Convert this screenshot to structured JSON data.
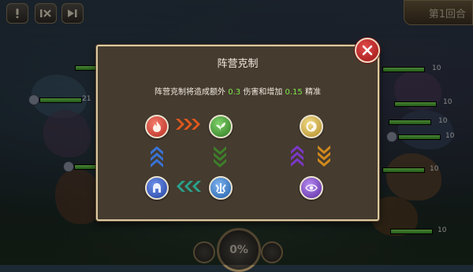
{
  "hud": {
    "round_label": "第1回合",
    "energy_label": "0%"
  },
  "units": {
    "left_levels": [
      "21"
    ],
    "right_levels": [
      "10",
      "10",
      "10",
      "10",
      "10",
      "10"
    ]
  },
  "dialog": {
    "title": "阵营克制",
    "desc_prefix": "阵营克制将造成额外",
    "damage_value": "0.3",
    "desc_middle": "伤害和增加",
    "accuracy_value": "0.15",
    "desc_suffix": "精准"
  },
  "factions": [
    {
      "icon": "fire-icon",
      "color": "#d8473a"
    },
    {
      "icon": "leaf-icon",
      "color": "#4fa43a"
    },
    {
      "icon": "water-icon",
      "color": "#3a78c9"
    },
    {
      "icon": "helmet-icon",
      "color": "#3b63c4"
    },
    {
      "icon": "light-icon",
      "color": "#d9b64a"
    },
    {
      "icon": "dark-icon",
      "color": "#7d45c8"
    }
  ],
  "arrow_colors": {
    "orange": "#e0581d",
    "blue": "#3973d6",
    "green": "#3d7f2a",
    "teal": "#2aa28c",
    "purple": "#7b38c7",
    "gold": "#d08a1c"
  },
  "accent": {
    "number_green": "#7ee84a",
    "close_red": "#c62828"
  }
}
